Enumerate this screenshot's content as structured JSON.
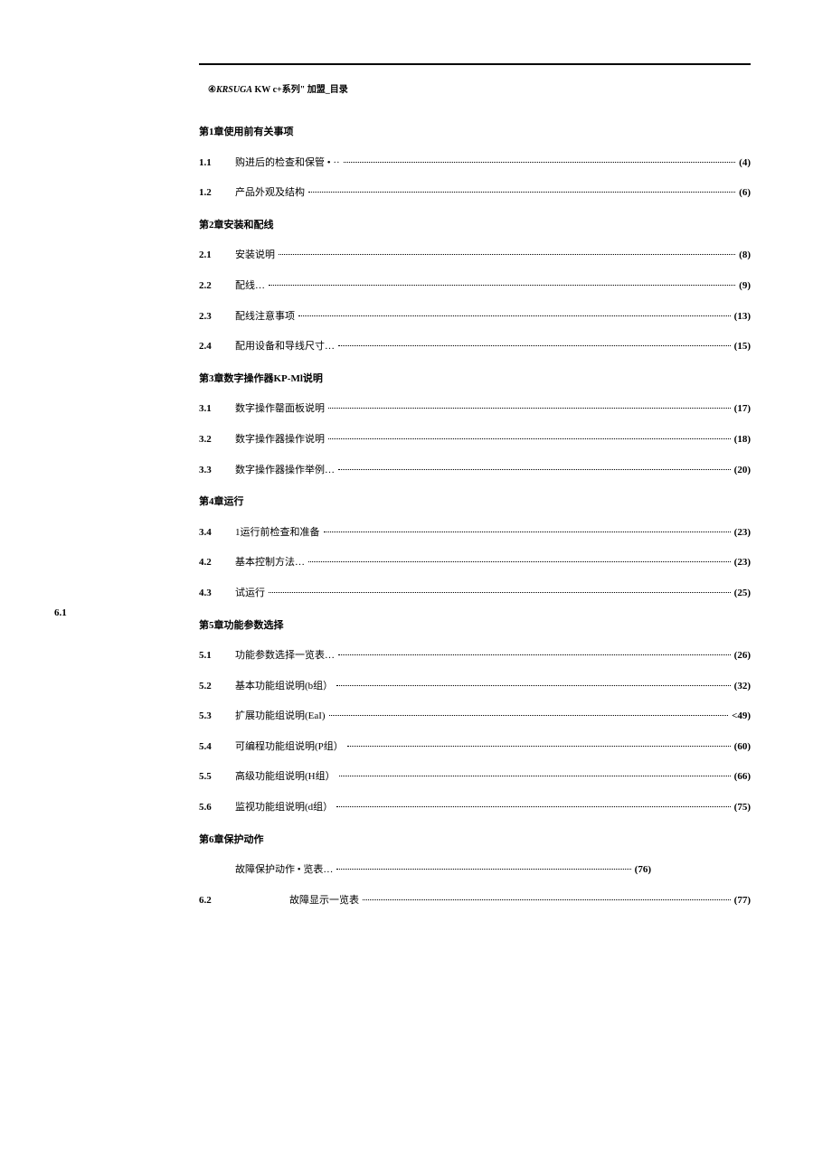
{
  "header": {
    "brand_prefix": "④",
    "brand": "KRSUGA",
    "model": " KW c+系列\"  加盟_目录"
  },
  "chapters": [
    {
      "title": "第1章使用前有关事项",
      "items": [
        {
          "num": "1.1",
          "label": "购进后的检查和保管 • ··",
          "page": "(4)"
        },
        {
          "num": "1.2",
          "label": "产品外观及结构",
          "page": "(6)"
        }
      ]
    },
    {
      "title": "第2章安装和配线",
      "items": [
        {
          "num": "2.1",
          "label": "安装说明",
          "page": "(8)"
        },
        {
          "num": "2.2",
          "label": "配线…",
          "page": "(9)"
        },
        {
          "num": "2.3",
          "label": "配线注意事项",
          "page": "(13)"
        },
        {
          "num": "2.4",
          "label": "配用设备和导线尺寸…",
          "page": "(15)"
        }
      ]
    },
    {
      "title": "第3章数字操作器KP-Ml说明",
      "items": [
        {
          "num": "3.1",
          "label": "数字操作罄面板说明",
          "page": "(17)"
        },
        {
          "num": "3.2",
          "label": "数字操作器操作说明",
          "page": "(18)"
        },
        {
          "num": "3.3",
          "label": "数字操作器操作举例…",
          "page": "(20)"
        }
      ]
    },
    {
      "title": "第4章运行",
      "items": [
        {
          "num": "3.4",
          "label": "1运行前检查和准备",
          "page": "(23)"
        },
        {
          "num": "4.2",
          "label": "基本控制方法…",
          "page": "(23)"
        },
        {
          "num": "4.3",
          "label": "试运行",
          "page": "(25)"
        }
      ]
    },
    {
      "title": "第5章功能参数选择",
      "items": [
        {
          "num": "5.1",
          "label": "功能参数选择一览表…",
          "page": "(26)"
        },
        {
          "num": "5.2",
          "label": "基本功能组说明(b组）",
          "page": "(32)"
        },
        {
          "num": "5.3",
          "label": "扩展功能组说明(EaI)",
          "page": "<49)"
        },
        {
          "num": "5.4",
          "label": "可编程功能组说明(P组）",
          "page": "(60)"
        },
        {
          "num": "5.5",
          "label": "高级功能组说明(H组）",
          "page": "(66)"
        },
        {
          "num": "5.6",
          "label": "监视功能组说明(d组）",
          "page": "(75)"
        }
      ]
    },
    {
      "title": "第6章保护动作",
      "items": []
    }
  ],
  "outdent_num": "6.1",
  "row61": {
    "label": "故障保护动作 • 览表…",
    "page": "(76)"
  },
  "row62": {
    "num": "6.2",
    "label": "故障显示一览表",
    "page": "(77)"
  }
}
